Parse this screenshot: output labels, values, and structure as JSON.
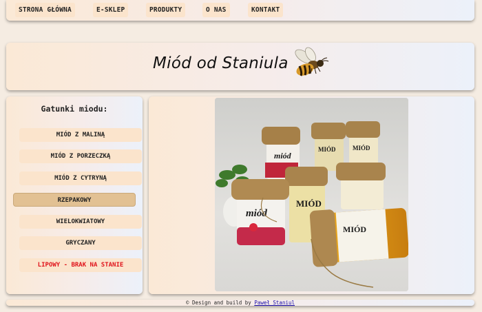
{
  "nav": {
    "items": [
      {
        "label": "STRONA GŁÓWNA"
      },
      {
        "label": "E-SKLEP"
      },
      {
        "label": "PRODUKTY"
      },
      {
        "label": "O NAS"
      },
      {
        "label": "KONTAKT"
      }
    ]
  },
  "header": {
    "title": "Miód od Staniula",
    "logo_icon": "bee-icon"
  },
  "sidebar": {
    "heading": "Gatunki miodu:",
    "items": [
      {
        "label": "MIÓD Z MALINĄ"
      },
      {
        "label": "MIÓD Z PORZECZKĄ"
      },
      {
        "label": "MIÓD Z CYTRYNĄ"
      },
      {
        "label": "RZEPAKOWY",
        "active": true
      },
      {
        "label": "WIELOKWIATOWY"
      },
      {
        "label": "GRYCZANY"
      },
      {
        "label": "LIPOWY - BRAK NA STANIE",
        "alert": true
      }
    ]
  },
  "main": {
    "photo_icon": "honey-jars-photo"
  },
  "footer": {
    "prefix": "© Design and build by ",
    "author": "Paweł Staniul"
  },
  "colors": {
    "button_bg": "#fbe4cc",
    "active_bg": "#e2c193",
    "alert_text": "#e0141c",
    "link": "#1a0dab"
  }
}
